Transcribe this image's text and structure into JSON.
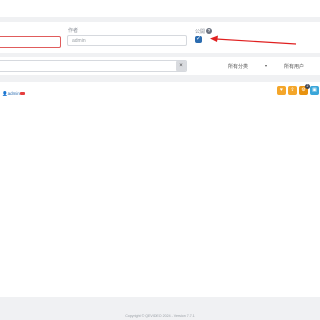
{
  "form": {
    "author_label": "作者",
    "author_value": "admin",
    "public_label": "公開",
    "help_glyph": "?",
    "checkbox_glyph": "✓"
  },
  "filter": {
    "clear_glyph": "×",
    "category_label": "所有分类",
    "category_arrow": "▾",
    "user_label": "所有用户"
  },
  "item": {
    "author": "admin",
    "user_glyph": "👤"
  },
  "actions": {
    "badge_count": "2",
    "buttons": [
      {
        "name": "like-button",
        "color": "#f4a62a",
        "glyph": "♥"
      },
      {
        "name": "share-button",
        "color": "#f4a62a",
        "glyph": "⇪"
      },
      {
        "name": "settings-button",
        "color": "#e8920f",
        "glyph": "⚙"
      },
      {
        "name": "copy-button",
        "color": "#3aa6d9",
        "glyph": "▣"
      }
    ]
  },
  "annotation": {
    "arrow_color": "#e02020"
  },
  "footer": {
    "copyright": "Copyright © QEVIDEO 2024 - Version 7.7.1"
  }
}
